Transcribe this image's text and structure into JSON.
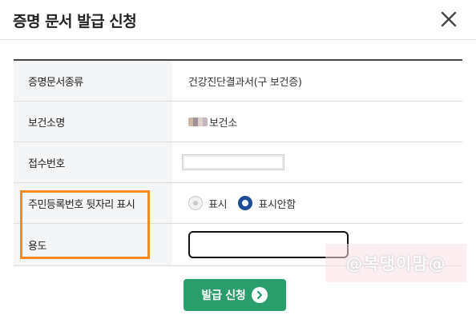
{
  "dialog": {
    "title": "증명 문서 발급 신청"
  },
  "form": {
    "rows": [
      {
        "label": "증명문서종류",
        "value": "건강진단결과서(구 보건증)"
      },
      {
        "label": "보건소명",
        "value": "보건소"
      },
      {
        "label": "접수번호",
        "value": ""
      },
      {
        "label": "주민등록번호 뒷자리 표시",
        "options": [
          "표시",
          "표시안함"
        ],
        "selected": "표시안함"
      },
      {
        "label": "용도",
        "value": ""
      }
    ]
  },
  "watermark": "@복댕이맘@",
  "submit_label": "발급 신청",
  "colors": {
    "submit": "#2a9d6d",
    "radio_selected": "#1d4c9a",
    "highlight": "#f6891f"
  }
}
